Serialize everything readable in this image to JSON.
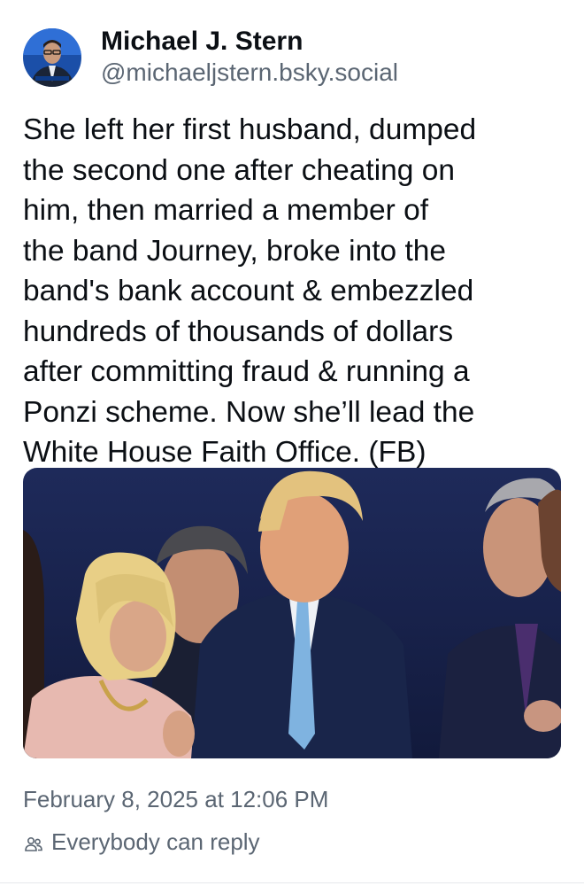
{
  "author": {
    "display_name": "Michael J. Stern",
    "handle": "@michaeljstern.bsky.social"
  },
  "post": {
    "text_lines": [
      "She left her first husband, dumped",
      "the second one after cheating on",
      "him, then married a member of",
      "the band Journey, broke into the",
      "band's bank account & embezzled",
      "hundreds of thousands of dollars",
      "after committing fraud & running a",
      "Ponzi scheme. Now she’ll lead the",
      "White House Faith Office.  (FB)"
    ],
    "timestamp": "February 8, 2025 at 12:06 PM",
    "reply_setting": "Everybody can reply",
    "reply_icon": "people-icon"
  },
  "colors": {
    "primary_text": "#0b0f14",
    "secondary_text": "#5b6673",
    "background": "#ffffff"
  }
}
